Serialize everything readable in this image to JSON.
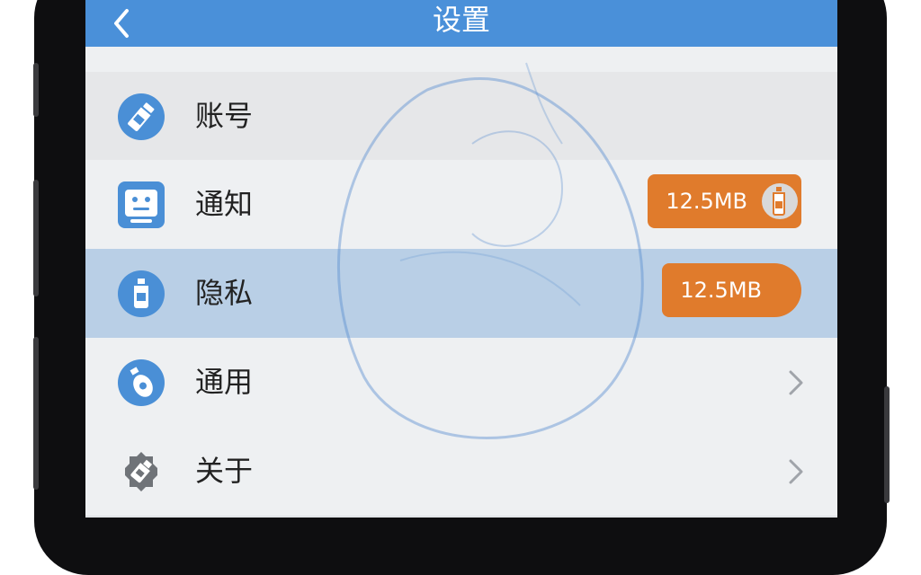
{
  "header": {
    "title": "设置",
    "back_icon": "chevron-left-icon"
  },
  "rows": [
    {
      "label": "账号",
      "icon": "bottle-icon",
      "badge": "",
      "chevron": false
    },
    {
      "label": "通知",
      "icon": "face-icon",
      "badge": "12.5MB",
      "chevron": false
    },
    {
      "label": "隐私",
      "icon": "bottle-icon",
      "badge": "12.5MB",
      "chevron": false,
      "selected": true
    },
    {
      "label": "通用",
      "icon": "bottle-icon",
      "badge": "",
      "chevron": true
    },
    {
      "label": "关于",
      "icon": "gear-icon",
      "badge": "",
      "chevron": true
    }
  ],
  "colors": {
    "nav": "#4a90d9",
    "badge": "#e07b2c",
    "highlight": "#b9cfe6"
  }
}
